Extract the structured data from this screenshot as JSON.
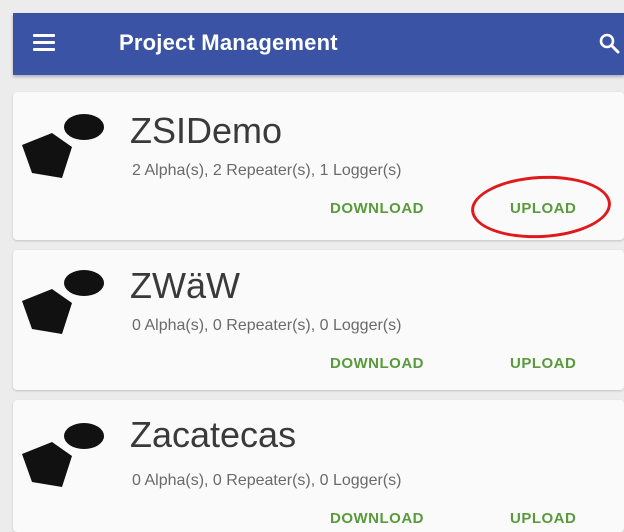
{
  "appbar": {
    "title": "Project Management",
    "menu_icon": "hamburger-menu-icon",
    "search_icon": "search-icon",
    "color": "#3a53a4"
  },
  "projects": [
    {
      "name": "ZSIDemo",
      "summary": "2 Alpha(s), 2 Repeater(s), 1 Logger(s)",
      "download_label": "DOWNLOAD",
      "upload_label": "UPLOAD",
      "icon": "project-logo-icon"
    },
    {
      "name": "ZWäW",
      "summary": "0 Alpha(s), 0 Repeater(s), 0 Logger(s)",
      "download_label": "DOWNLOAD",
      "upload_label": "UPLOAD",
      "icon": "project-logo-icon"
    },
    {
      "name": "Zacatecas",
      "summary": "0 Alpha(s), 0 Repeater(s), 0 Logger(s)",
      "download_label": "DOWNLOAD",
      "upload_label": "UPLOAD",
      "icon": "project-logo-icon"
    }
  ],
  "accent_color": "#5a9a3c",
  "annotation_color": "#e0191d"
}
